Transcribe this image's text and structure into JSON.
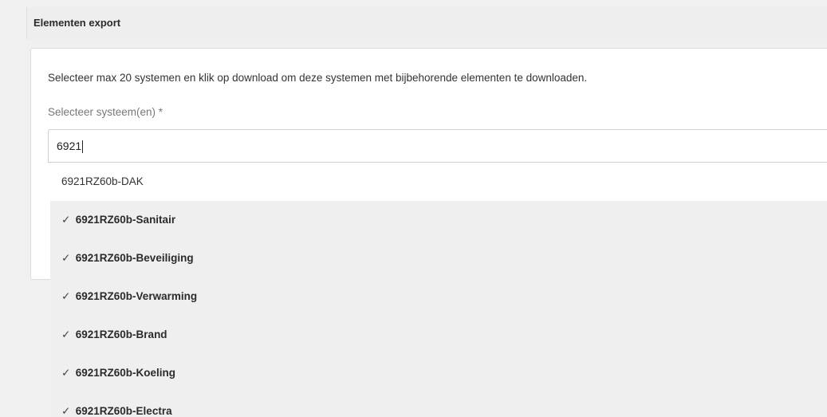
{
  "panel": {
    "title": "Elementen export"
  },
  "card": {
    "intro": "Selecteer max 20 systemen en klik op download om deze systemen met bijbehorende elementen te downloaden.",
    "field_label": "Selecteer systeem(en) *"
  },
  "search": {
    "value": "6921"
  },
  "dropdown": {
    "check_glyph": "✓",
    "options": [
      {
        "label": "6921RZ60b-DAK",
        "selected": false
      },
      {
        "label": "6921RZ60b-Sanitair",
        "selected": true
      },
      {
        "label": "6921RZ60b-Beveiliging",
        "selected": true
      },
      {
        "label": "6921RZ60b-Verwarming",
        "selected": true
      },
      {
        "label": "6921RZ60b-Brand",
        "selected": true
      },
      {
        "label": "6921RZ60b-Koeling",
        "selected": true
      },
      {
        "label": "6921RZ60b-Electra",
        "selected": true
      }
    ]
  }
}
